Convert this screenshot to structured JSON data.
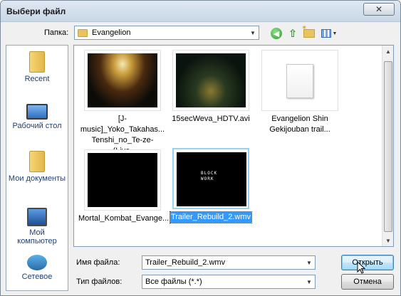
{
  "window": {
    "title": "Выбери файл",
    "close_symbol": "✕"
  },
  "toolbar": {
    "look_in_label": "Папка:",
    "look_in_value": "Evangelion",
    "icons": [
      "back-icon",
      "up-folder-icon",
      "new-folder-icon",
      "view-menu-icon"
    ]
  },
  "places": [
    {
      "label": "Recent",
      "icon": "recent-folder-icon"
    },
    {
      "label": "Рабочий стол",
      "icon": "desktop-icon"
    },
    {
      "label": "Мои документы",
      "icon": "documents-folder-icon"
    },
    {
      "label": "Мой компьютер",
      "icon": "computer-icon"
    },
    {
      "label": "Сетевое",
      "icon": "network-icon"
    }
  ],
  "files": [
    {
      "name": "[J-music]_Yoko_Takahas... Tenshi_no_Te-ze-_(Live...",
      "thumb": "concert-video-thumbnail",
      "selected": false
    },
    {
      "name": "15secWeva_HDTV.avi",
      "thumb": "anime-video-thumbnail",
      "selected": false
    },
    {
      "name": "Evangelion Shin Gekijouban trail...",
      "thumb": "document-icon",
      "selected": false
    },
    {
      "name": "Mortal_Kombat_Evange...",
      "thumb": "black-video-thumbnail",
      "selected": false
    },
    {
      "name": "Trailer_Rebuild_2.wmv",
      "thumb": "logo-video-thumbnail",
      "selected": true
    }
  ],
  "logo_text": "BLOCK\nWORK",
  "bottom": {
    "filename_label": "Имя файла:",
    "filename_value": "Trailer_Rebuild_2.wmv",
    "filetype_label": "Тип файлов:",
    "filetype_value": "Все файлы (*.*)",
    "open_button": "Открыть",
    "cancel_button": "Отмена"
  },
  "colors": {
    "accent_selection": "#3399ff",
    "default_button": "#bee6fd"
  }
}
